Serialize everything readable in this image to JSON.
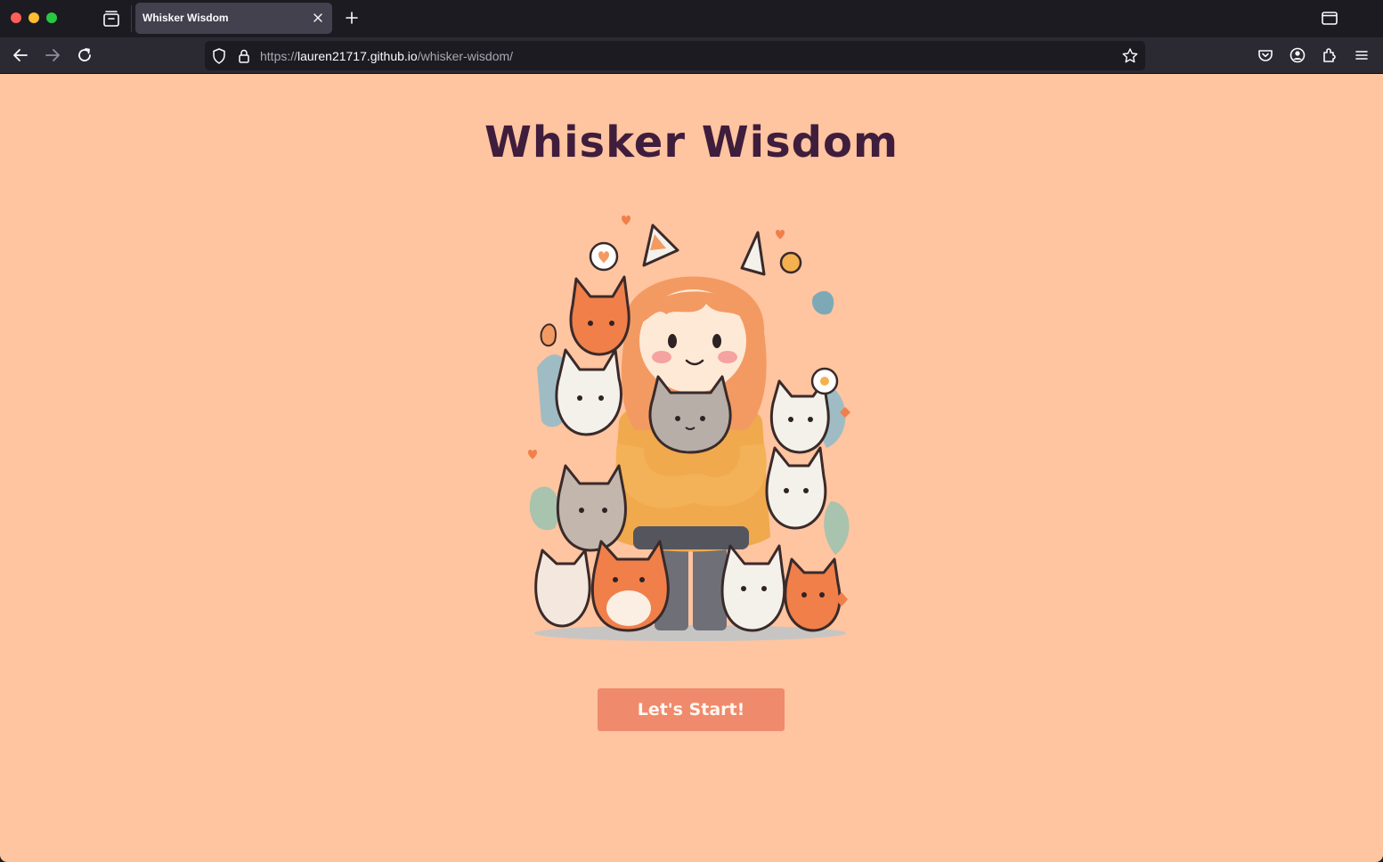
{
  "browser": {
    "tab_title": "Whisker Wisdom",
    "url_prefix": "https://",
    "url_host": "lauren21717.github.io",
    "url_path": "/whisker-wisdom/"
  },
  "page": {
    "title": "Whisker Wisdom",
    "start_button": "Let's Start!",
    "illustration_alt": "girl-with-cats-illustration"
  },
  "colors": {
    "background": "#ffc4a0",
    "title": "#3f1d3c",
    "button": "#ef8a6c"
  }
}
